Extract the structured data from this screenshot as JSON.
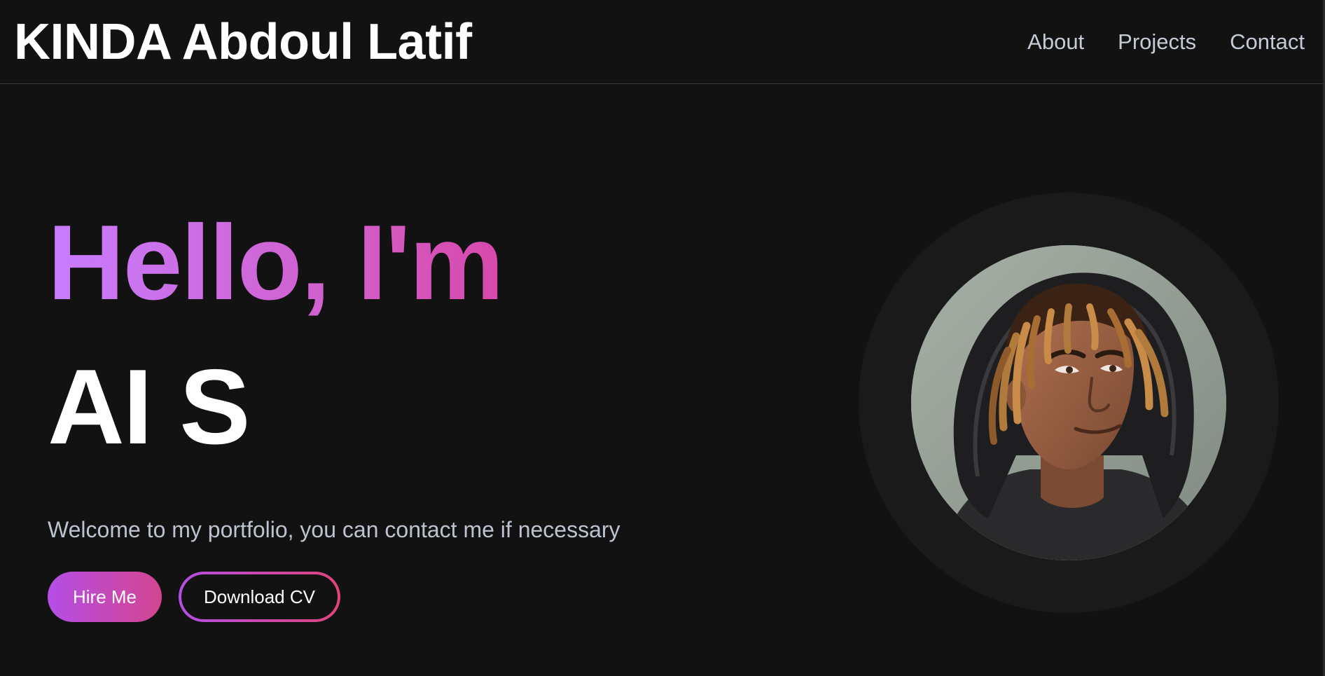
{
  "header": {
    "brand": "KINDA Abdoul Latif",
    "nav": [
      {
        "label": "About"
      },
      {
        "label": "Projects"
      },
      {
        "label": "Contact"
      }
    ]
  },
  "hero": {
    "greeting": "Hello, I'm",
    "role": "AI S",
    "tagline": "Welcome to my portfolio, you can contact me if necessary",
    "primary_button": "Hire Me",
    "secondary_button": "Download CV"
  },
  "colors": {
    "background": "#121212",
    "gradient_start": "#c77dff",
    "gradient_end": "#e0267a",
    "text_primary": "#ffffff",
    "text_muted": "#bcc3cf"
  },
  "avatar": {
    "icon": "profile-illustration"
  }
}
